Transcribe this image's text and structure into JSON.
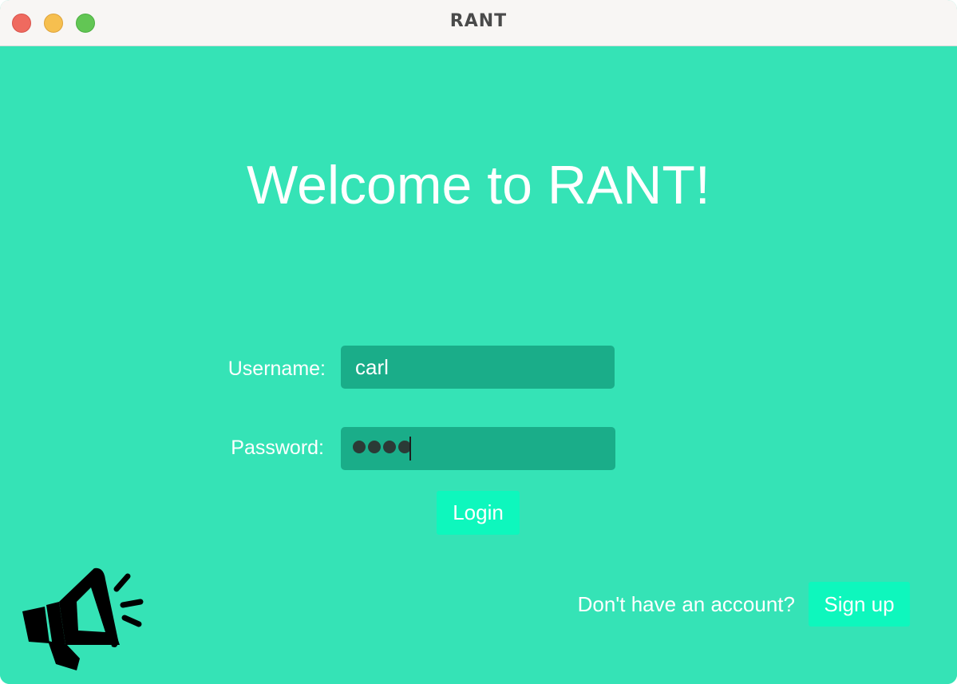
{
  "window": {
    "title": "RANT"
  },
  "welcome": {
    "heading": "Welcome to RANT!"
  },
  "login_form": {
    "username_label": "Username:",
    "username_value": "carl",
    "password_label": "Password:",
    "password_masked_length": 4,
    "login_button": "Login"
  },
  "footer": {
    "account_prompt": "Don't have an account?",
    "signup_button": "Sign up"
  },
  "colors": {
    "background": "#35e3b6",
    "field": "#1aad89",
    "button": "#0ef7bd",
    "text": "#ffffff"
  },
  "icons": {
    "logo": "megaphone-icon"
  }
}
